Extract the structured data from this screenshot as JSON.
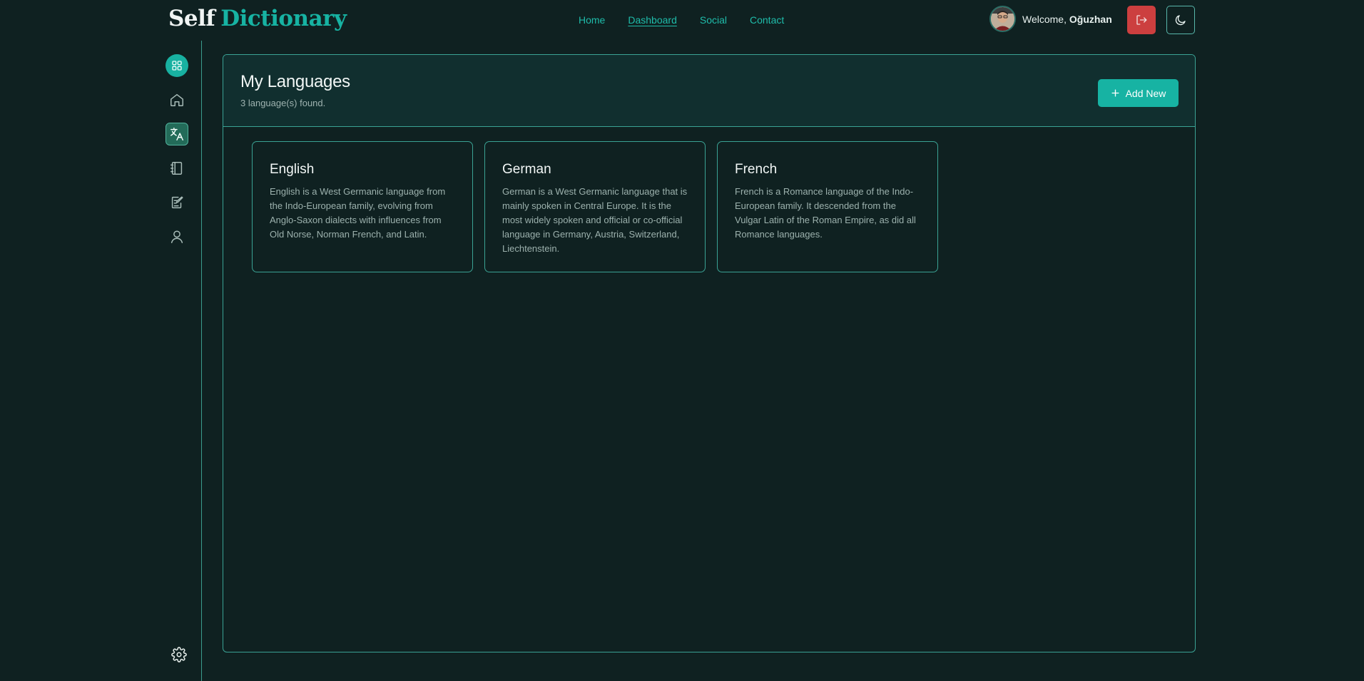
{
  "brand": {
    "word1": "Self",
    "word2": "Dictionary"
  },
  "nav": {
    "items": [
      {
        "label": "Home",
        "active": false
      },
      {
        "label": "Dashboard",
        "active": true
      },
      {
        "label": "Social",
        "active": false
      },
      {
        "label": "Contact",
        "active": false
      }
    ]
  },
  "user": {
    "welcome_prefix": "Welcome,",
    "name": "Oğuzhan"
  },
  "header_actions": {
    "logout_icon": "logout-icon",
    "theme_icon": "moon-icon"
  },
  "sidebar": {
    "items": [
      {
        "icon": "dashboard-grid-icon",
        "style": "round"
      },
      {
        "icon": "home-icon",
        "style": "plain"
      },
      {
        "icon": "translate-icon",
        "style": "active"
      },
      {
        "icon": "notebook-icon",
        "style": "plain"
      },
      {
        "icon": "edit-note-icon",
        "style": "plain"
      },
      {
        "icon": "user-icon",
        "style": "plain"
      }
    ],
    "footer_icon": "settings-icon"
  },
  "main": {
    "title": "My Languages",
    "count_text": "3 language(s) found.",
    "add_button_label": "Add New",
    "languages": [
      {
        "name": "English",
        "description": "English is a West Germanic language from the Indo-European family, evolving from Anglo-Saxon dialects with influences from Old Norse, Norman French, and Latin."
      },
      {
        "name": "German",
        "description": "German is a West Germanic language that is mainly spoken in Central Europe. It is the most widely spoken and official or co-official language in Germany, Austria, Switzerland, Liechtenstein."
      },
      {
        "name": "French",
        "description": "French is a Romance language of the Indo-European family. It descended from the Vulgar Latin of the Roman Empire, as did all Romance languages."
      }
    ]
  },
  "colors": {
    "background": "#0f2121",
    "accent": "#17b3a3",
    "danger": "#cc3f3f",
    "border": "#3aa294"
  }
}
